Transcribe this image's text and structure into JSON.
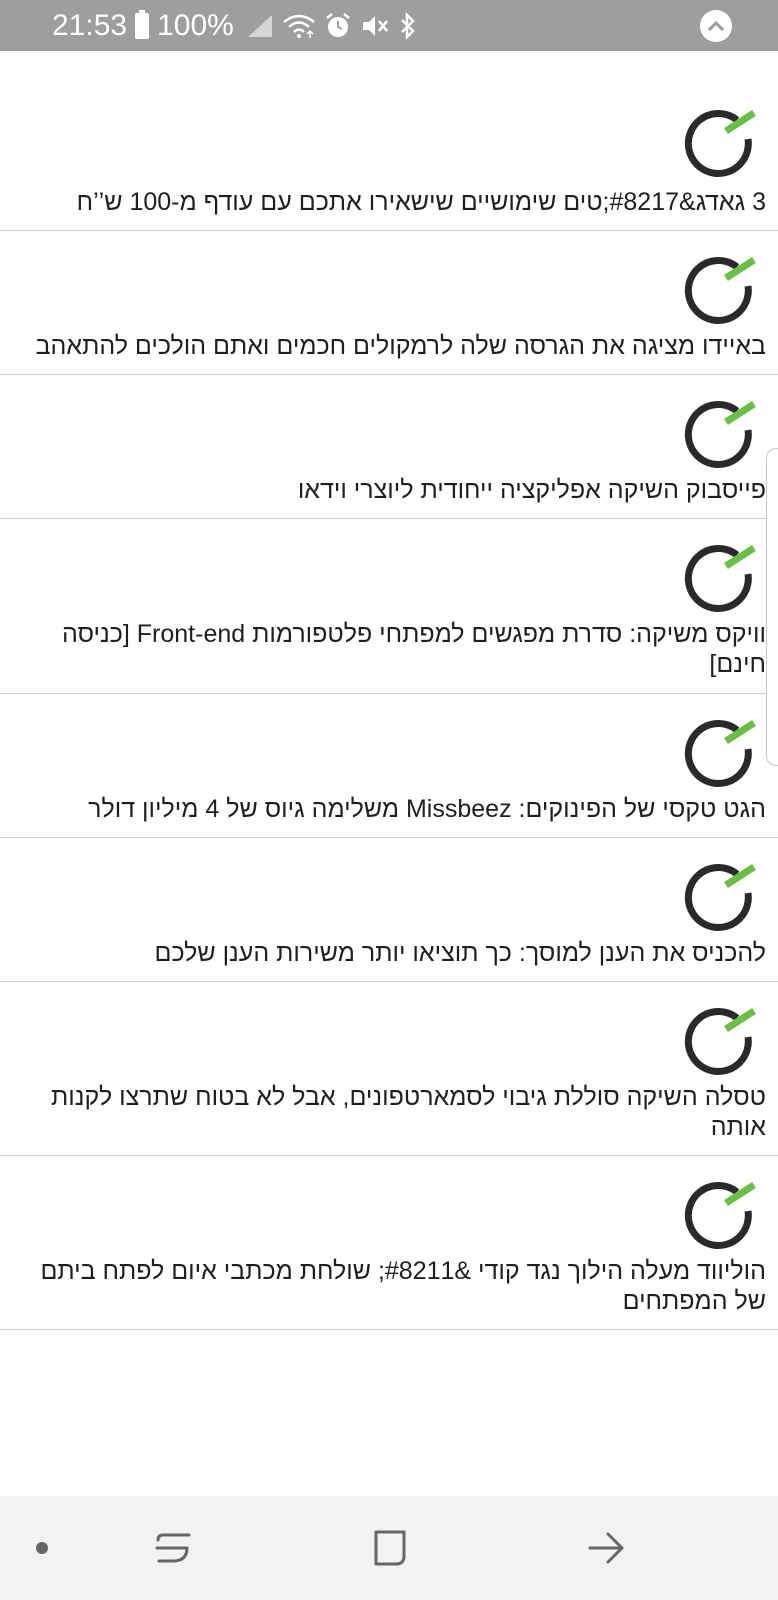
{
  "status_bar": {
    "time": "21:53",
    "battery": "100%",
    "icons": [
      "battery-icon",
      "signal-icon",
      "wifi-icon",
      "alarm-icon",
      "mute-icon",
      "bluetooth-icon"
    ],
    "expand_icon": "chevron-up-icon"
  },
  "colors": {
    "status_bar_bg": "#9e9e9e",
    "icon_dark": "#2a2a2a",
    "icon_accent": "#6abf45",
    "divider": "#d0d0d0",
    "nav_bg": "#f2f2f2"
  },
  "feed": {
    "items": [
      {
        "title": "3 גאדג&#8217;טים שימושיים שישאירו אתכם עם עודף מ-100 ש’’ח",
        "icon": "app-logo-icon"
      },
      {
        "title": "באיידו מציגה את הגרסה שלה לרמקולים חכמים ואתם הולכים להתאהב",
        "icon": "app-logo-icon"
      },
      {
        "title": "פייסבוק השיקה אפליקציה ייחודית ליוצרי וידאו",
        "icon": "app-logo-icon"
      },
      {
        "title": "וויקס משיקה: סדרת מפגשים למפתחי פלטפורמות Front-end [כניסה חינם]",
        "icon": "app-logo-icon"
      },
      {
        "title": "הגט טקסי של הפינוקים: Missbeez משלימה גיוס של 4 מיליון דולר",
        "icon": "app-logo-icon"
      },
      {
        "title": "להכניס את הענן למוסך: כך תוציאו יותר משירות הענן שלכם",
        "icon": "app-logo-icon"
      },
      {
        "title": "טסלה השיקה סוללת גיבוי לסמארטפונים, אבל לא בטוח שתרצו לקנות אותה",
        "icon": "app-logo-icon"
      },
      {
        "title": "הוליווד מעלה הילוך נגד קודי &#8211; שולחת מכתבי איום לפתח ביתם של המפתחים",
        "icon": "app-logo-icon"
      }
    ]
  },
  "nav_bar": {
    "buttons": [
      "dot-icon",
      "recent-apps-icon",
      "home-icon",
      "back-icon"
    ]
  }
}
